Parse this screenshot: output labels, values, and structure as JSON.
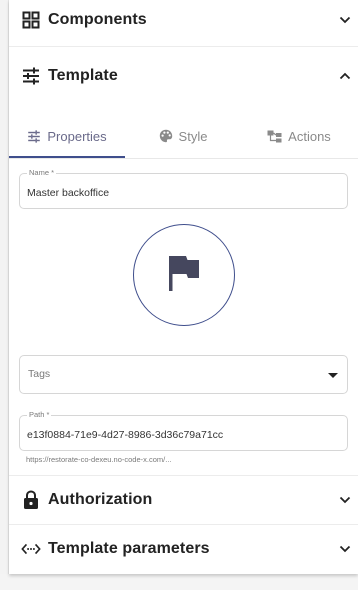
{
  "sections": {
    "components": {
      "title": "Components",
      "icon": "grid-icon",
      "state": "collapsed"
    },
    "template": {
      "title": "Template",
      "icon": "tune-icon",
      "state": "expanded"
    },
    "authorization": {
      "title": "Authorization",
      "icon": "lock-icon",
      "state": "collapsed"
    },
    "template_parameters": {
      "title": "Template parameters",
      "icon": "code-brackets-icon",
      "state": "collapsed"
    }
  },
  "tabs": [
    {
      "label": "Properties",
      "icon": "tune-icon",
      "active": true
    },
    {
      "label": "Style",
      "icon": "palette-icon",
      "active": false
    },
    {
      "label": "Actions",
      "icon": "flow-icon",
      "active": false
    }
  ],
  "form": {
    "name": {
      "label": "Name *",
      "value": "Master backoffice"
    },
    "icon": {
      "name": "flag-icon"
    },
    "tags": {
      "placeholder": "Tags"
    },
    "path": {
      "label": "Path *",
      "value": "e13f0884-71e9-4d27-8986-3d36c79a71cc",
      "hint": "https://restorate-co-dexeu.no-code-x.com/..."
    }
  },
  "colors": {
    "accent": "#3f4e8c",
    "icon": "#45475e"
  }
}
